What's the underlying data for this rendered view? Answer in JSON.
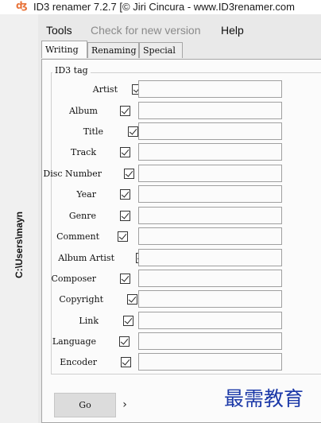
{
  "window": {
    "title": "ID3 renamer 7.2.7 [© Jiri Cincura - www.ID3renamer.com",
    "app_icon": "id3-logo-icon"
  },
  "sidebar": {
    "path": "C:\\Users\\mayn"
  },
  "menu": {
    "tools": "Tools",
    "check": "Check for new version",
    "help": "Help"
  },
  "tabs": [
    "Writing",
    "Renaming",
    "Special"
  ],
  "active_tab": "Writing",
  "group": {
    "label": "ID3 tag"
  },
  "fields": [
    {
      "label": "Artist",
      "checked": true,
      "value": ""
    },
    {
      "label": "Album",
      "checked": true,
      "value": ""
    },
    {
      "label": "Title",
      "checked": true,
      "value": ""
    },
    {
      "label": "Track",
      "checked": true,
      "value": ""
    },
    {
      "label": "Disc Number",
      "checked": true,
      "value": ""
    },
    {
      "label": "Year",
      "checked": true,
      "value": ""
    },
    {
      "label": "Genre",
      "checked": true,
      "value": ""
    },
    {
      "label": "Comment",
      "checked": true,
      "value": ""
    },
    {
      "label": "Album Artist",
      "checked": true,
      "value": ""
    },
    {
      "label": "Composer",
      "checked": true,
      "value": ""
    },
    {
      "label": "Copyright",
      "checked": true,
      "value": ""
    },
    {
      "label": "Link",
      "checked": true,
      "value": ""
    },
    {
      "label": "Language",
      "checked": true,
      "value": ""
    },
    {
      "label": "Encoder",
      "checked": true,
      "value": ""
    }
  ],
  "go_button": {
    "label": "Go",
    "more": "›"
  },
  "watermark": "最需教育"
}
